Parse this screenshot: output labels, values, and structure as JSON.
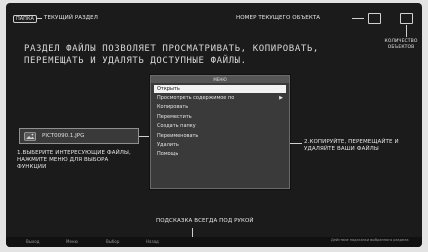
{
  "top_left": {
    "badge": "ПАПКА",
    "label": "ТЕКУЩИЙ РАЗДЕЛ"
  },
  "top_right": {
    "label": "НОМЕР ТЕКУЩЕГО ОБЪЕКТА",
    "count_label": "КОЛИЧЕСТВО ОБЪЕКТОВ"
  },
  "headline": "РАЗДЕЛ ФАЙЛЫ ПОЗВОЛЯЕТ ПРОСМАТРИВАТЬ, КОПИРОВАТЬ, ПЕРЕМЕЩАТЬ И УДАЛЯТЬ ДОСТУПНЫЕ ФАЙЛЫ.",
  "file": {
    "name": "PICT0090.1.JPG",
    "icon": "image-file-icon"
  },
  "menu": {
    "header": "МЕНЮ",
    "items": [
      {
        "label": "Открыть",
        "selected": true,
        "has_submenu": false
      },
      {
        "label": "Просмотреть содержимое по",
        "selected": false,
        "has_submenu": true
      },
      {
        "label": "Копировать",
        "selected": false,
        "has_submenu": false
      },
      {
        "label": "Переместить",
        "selected": false,
        "has_submenu": false
      },
      {
        "label": "Создать папку",
        "selected": false,
        "has_submenu": false
      },
      {
        "label": "Переименовать",
        "selected": false,
        "has_submenu": false
      },
      {
        "label": "Удалить",
        "selected": false,
        "has_submenu": false
      },
      {
        "label": "Помощь",
        "selected": false,
        "has_submenu": false
      }
    ]
  },
  "left_callout": "1.ВЫБЕРИТЕ ИНТЕРЕСУЮЩИЕ ФАЙЛЫ, НАЖМИТЕ МЕНЮ ДЛЯ ВЫБОРА ФУНКЦИИ",
  "right_callout": "2.КОПИРУЙТЕ, ПЕРЕМЕЩАЙТЕ И УДАЛЯЙТЕ ВАШИ ФАЙЛЫ",
  "bottom_callout": "ПОДСКАЗКА ВСЕГДА ПОД РУКОЙ",
  "bottom_bar": {
    "left_items": [
      "Выход",
      "Меню",
      "Выбор",
      "Назад"
    ],
    "right_label": "Действие подсказки выбранного раздела"
  }
}
